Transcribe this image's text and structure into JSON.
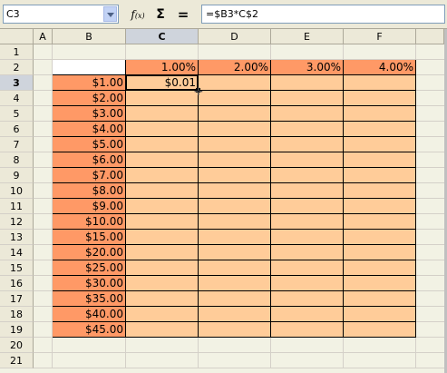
{
  "formula_bar": {
    "name_box": "C3",
    "function_wizard_symbol": "f",
    "function_wizard_sub": "(x)",
    "sum_symbol": "Σ",
    "equals_symbol": "=",
    "formula": "=$B3*C$2"
  },
  "sheet": {
    "column_headers": [
      "A",
      "B",
      "C",
      "D",
      "E",
      "F"
    ],
    "row_headers": [
      "1",
      "2",
      "3",
      "4",
      "5",
      "6",
      "7",
      "8",
      "9",
      "10",
      "11",
      "12",
      "13",
      "14",
      "15",
      "16",
      "17",
      "18",
      "19",
      "20",
      "21"
    ],
    "rate_headers": [
      "1.00%",
      "2.00%",
      "3.00%",
      "4.00%"
    ],
    "amounts": [
      "$1.00",
      "$2.00",
      "$3.00",
      "$4.00",
      "$5.00",
      "$6.00",
      "$7.00",
      "$8.00",
      "$9.00",
      "$10.00",
      "$15.00",
      "$20.00",
      "$25.00",
      "$30.00",
      "$35.00",
      "$40.00",
      "$45.00"
    ],
    "active_cell": "C3",
    "active_cell_value": "$0.01"
  },
  "colors": {
    "amount_fill": "#ff9966",
    "data_fill": "#ffcc99",
    "header_fill": "#ff9966"
  }
}
